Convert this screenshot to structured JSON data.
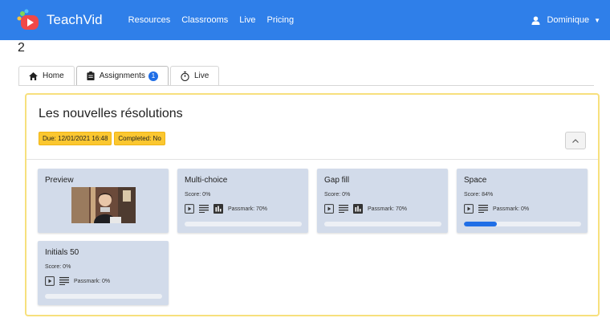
{
  "navbar": {
    "brand": "TeachVid",
    "links": [
      "Resources",
      "Classrooms",
      "Live",
      "Pricing"
    ],
    "user": "Dominique"
  },
  "stray_text": "2",
  "tabs": [
    {
      "label": "Home",
      "icon": "home-icon"
    },
    {
      "label": "Assignments",
      "icon": "clipboard-icon",
      "badge": "1"
    },
    {
      "label": "Live",
      "icon": "stopwatch-icon"
    }
  ],
  "assignment": {
    "title": "Les nouvelles résolutions",
    "due": "Due: 12/01/2021 16:48",
    "completed": "Completed: No"
  },
  "cards": [
    {
      "title": "Preview"
    },
    {
      "title": "Multi-choice",
      "score": "Score: 0%",
      "passmark": "Passmark: 70%",
      "progress": 0
    },
    {
      "title": "Gap fill",
      "score": "Score: 0%",
      "passmark": "Passmark: 70%",
      "progress": 0
    },
    {
      "title": "Space",
      "score": "Score: 84%",
      "passmark": "Passmark: 0%",
      "progress": 0.28
    },
    {
      "title": "Initials 50",
      "score": "Score: 0%",
      "passmark": "Passmark: 0%",
      "progress": 0
    }
  ],
  "colors": {
    "navbar": "#2f7fe9",
    "accent": "#1f6ee6",
    "panel_border": "#f7e07d",
    "tag": "#fbc730",
    "card": "#d2dbea"
  }
}
